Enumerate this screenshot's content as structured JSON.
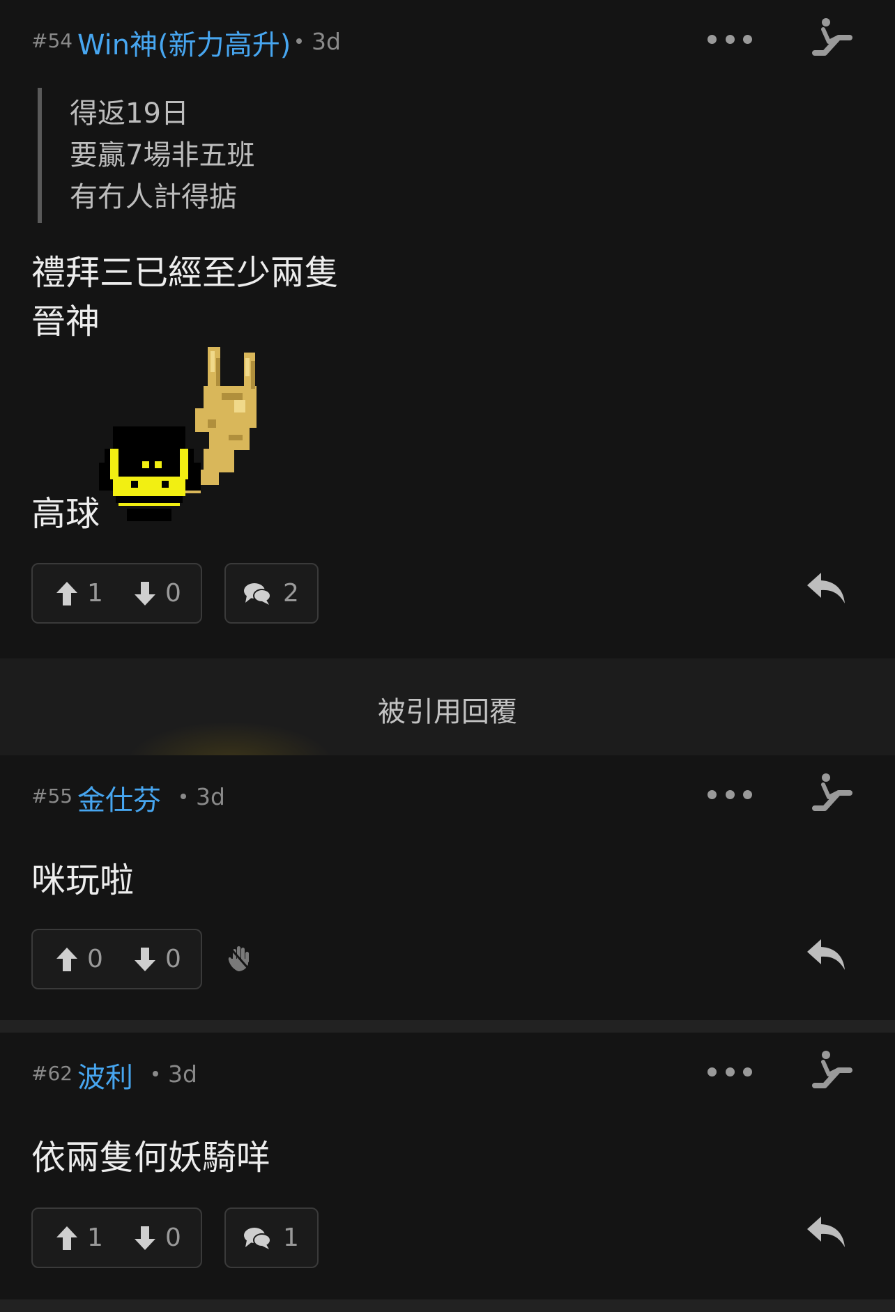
{
  "posts": [
    {
      "number": "#54",
      "username": "Win神(新力高升)",
      "time": "3d",
      "quote_lines": [
        "得返19日",
        "要贏7場非五班",
        "有冇人計得掂"
      ],
      "body_lines": [
        "禮拜三已經至少兩隻",
        "晉神",
        "高球"
      ],
      "upvotes": "1",
      "downvotes": "0",
      "comments": "2"
    },
    {
      "number": "#55",
      "username": "金仕芬",
      "time": "3d",
      "body_lines": [
        "咪玩啦"
      ],
      "upvotes": "0",
      "downvotes": "0"
    },
    {
      "number": "#62",
      "username": "波利",
      "time": "3d",
      "body_lines": [
        "依兩隻何妖騎咩"
      ],
      "upvotes": "1",
      "downvotes": "0",
      "comments": "1"
    }
  ],
  "quoted_replies_label": "被引用回覆",
  "icons": {
    "more": "more-dots-icon",
    "moderator": "escalator-icon",
    "upvote": "arrow-up-icon",
    "downvote": "arrow-down-icon",
    "comment": "comment-bubble-icon",
    "reply": "reply-icon",
    "no-comments": "hand-icon",
    "sticker": "pixel-smiley-rock-hand-sticker"
  },
  "colors": {
    "background": "#121212",
    "username": "#47a6f0",
    "meta": "#8a8a8a"
  }
}
